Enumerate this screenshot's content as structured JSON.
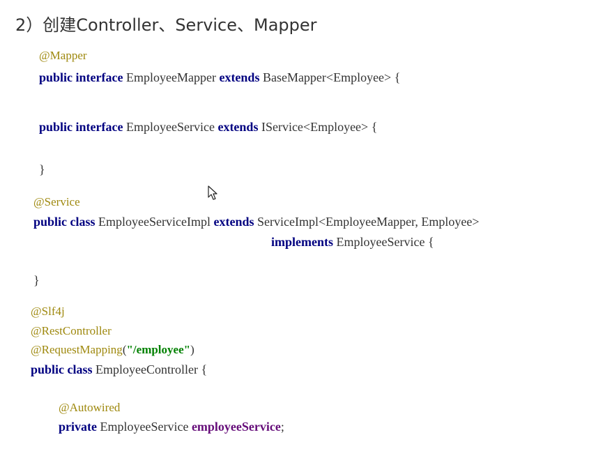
{
  "heading": "2）创建Controller、Service、Mapper",
  "mapper_block": {
    "annotation": "@Mapper",
    "line": {
      "kw1": "public",
      "kw2": "interface",
      "name": "EmployeeMapper",
      "kw3": "extends",
      "rest": "BaseMapper<Employee> {"
    }
  },
  "service_block": {
    "line": {
      "kw1": "public",
      "kw2": "interface",
      "name": "EmployeeService",
      "kw3": "extends",
      "rest": "IService<Employee> {"
    },
    "close": "}"
  },
  "impl_block": {
    "annotation": "@Service",
    "line1": {
      "kw1": "public",
      "kw2": "class",
      "name": "EmployeeServiceImpl",
      "kw3": "extends",
      "rest": "ServiceImpl<EmployeeMapper, Employee>"
    },
    "line2": {
      "kw": "implements",
      "rest": "EmployeeService {"
    },
    "close": "}"
  },
  "controller_block": {
    "annotation1": "@Slf4j",
    "annotation2": "@RestController",
    "annotation3_name": "@RequestMapping",
    "annotation3_paren_open": "(",
    "annotation3_value": "\"/employee\"",
    "annotation3_paren_close": ")",
    "line": {
      "kw1": "public",
      "kw2": "class",
      "rest": "EmployeeController {"
    },
    "field_annotation": "@Autowired",
    "field_line": {
      "kw": "private",
      "type": "EmployeeService",
      "name": "employeeService",
      "end": ";"
    }
  }
}
